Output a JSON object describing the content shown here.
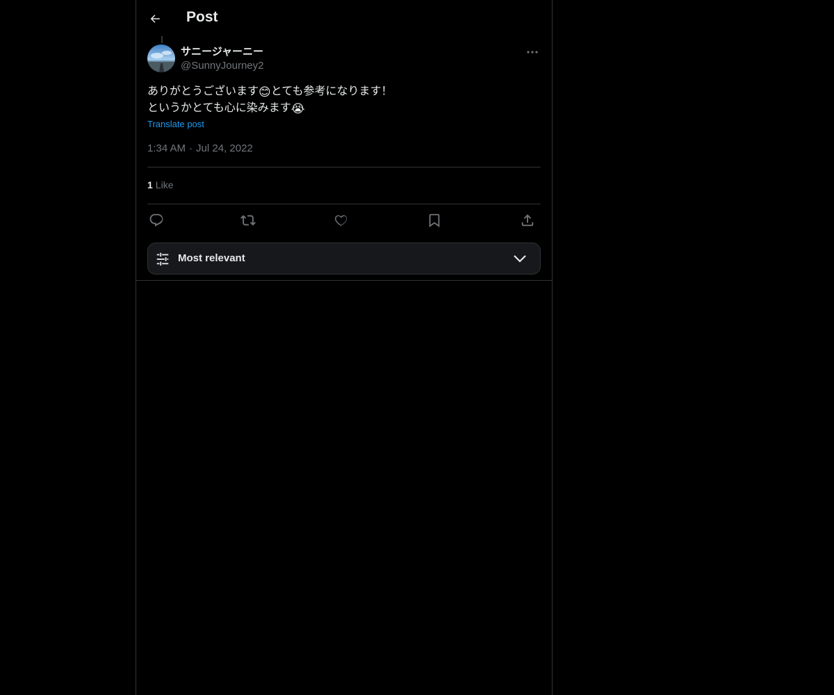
{
  "header": {
    "title": "Post",
    "back_icon": "arrow-left-icon"
  },
  "post": {
    "author": {
      "display_name": "サニージャーニー",
      "handle": "@SunnyJourney2",
      "avatar_icon": "avatar-photo"
    },
    "text_line1_part1": "ありがとうございます",
    "emoji1": "😊",
    "text_line1_part2": "とても参考になります！",
    "text_line2": "というかとても心に染みます",
    "emoji2": "😭",
    "translate_label": "Translate post",
    "time": "1:34 AM",
    "separator": "·",
    "date": "Jul 24, 2022",
    "likes_count": "1",
    "likes_label": "Like"
  },
  "actions": [
    "reply-icon",
    "repost-icon",
    "like-icon",
    "bookmark-icon",
    "share-icon"
  ],
  "sort": {
    "label": "Most relevant",
    "icon": "sliders-icon",
    "chevron": "chevron-down-icon"
  },
  "colors": {
    "background": "#000000",
    "text": "#e7e9ea",
    "muted": "#71767b",
    "link": "#1d9bf0",
    "border": "#2f3336"
  }
}
